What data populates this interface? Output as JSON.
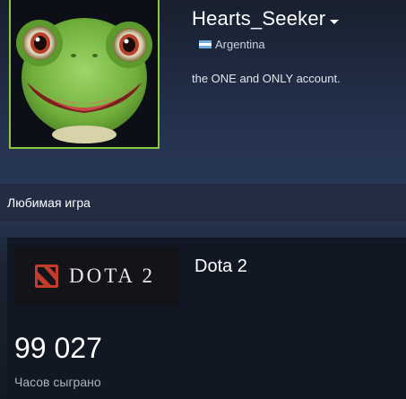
{
  "profile": {
    "name": "Hearts_Seeker",
    "location": "Argentina",
    "summary": "the ONE and ONLY account.",
    "avatar_icon": "frog-avatar",
    "avatar_border_color": "#8ec63c"
  },
  "favorite_game": {
    "section_title": "Любимая игра",
    "capsule_logo_text": "DOTA 2",
    "game_name": "Dota 2",
    "hours_value": "99 027",
    "hours_label": "Часов сыграно",
    "logo_color": "#c23c2a"
  }
}
